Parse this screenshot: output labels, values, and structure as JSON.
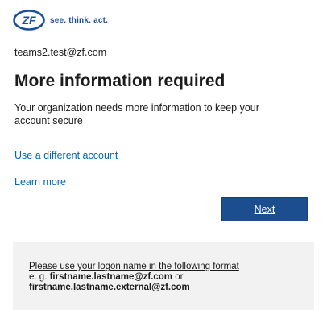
{
  "brand": {
    "tagline": "see. think. act."
  },
  "account": {
    "identity": "teams2.test@zf.com"
  },
  "main": {
    "title": "More information required",
    "description": "Your organization needs more information to keep your account secure",
    "use_different_account_link": "Use a different account",
    "learn_more_link": "Learn more",
    "next_button": "Next"
  },
  "footer": {
    "line1": "Please use your logon name in the following format",
    "line2_prefix": "e. g. ",
    "line2_bold": "firstname.lastname@zf.com",
    "line2_suffix": " or",
    "line3_bold": "firstname.lastname.external@zf.com"
  },
  "colors": {
    "link": "#0067b8",
    "button": "#1c4e8f",
    "brand": "#1a4f9c",
    "footer_bg": "#f2f2f2"
  }
}
